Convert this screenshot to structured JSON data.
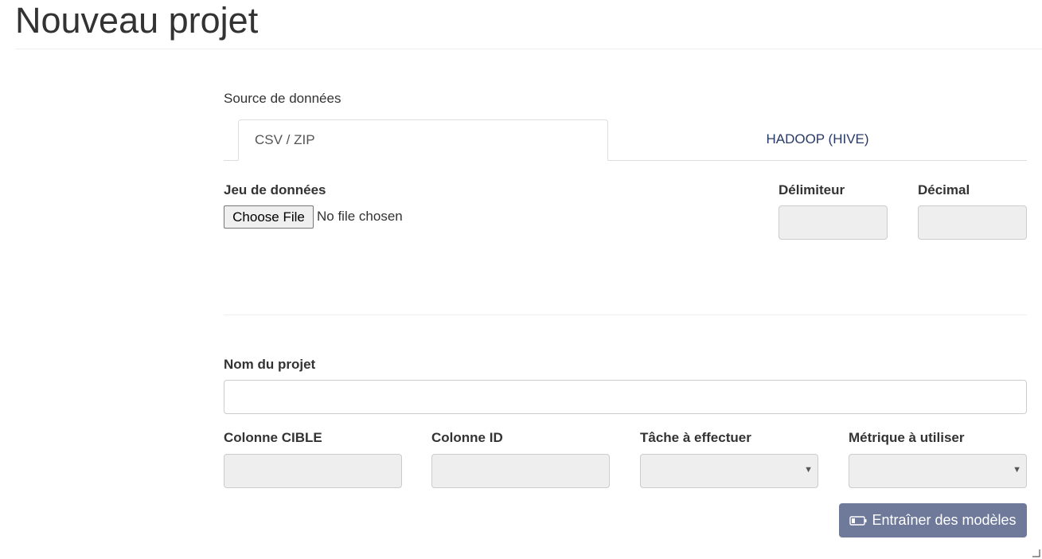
{
  "page": {
    "title": "Nouveau projet"
  },
  "source": {
    "label": "Source de données",
    "tabs": [
      {
        "label": "CSV / ZIP",
        "active": true
      },
      {
        "label": "HADOOP (HIVE)",
        "active": false
      }
    ]
  },
  "dataset": {
    "label": "Jeu de données",
    "file_button": "Choose File",
    "file_status": "No file chosen"
  },
  "delimiter": {
    "label": "Délimiteur",
    "value": ""
  },
  "decimal": {
    "label": "Décimal",
    "value": ""
  },
  "project_name": {
    "label": "Nom du projet",
    "value": ""
  },
  "target_column": {
    "label": "Colonne CIBLE",
    "value": ""
  },
  "id_column": {
    "label": "Colonne ID",
    "value": ""
  },
  "task": {
    "label": "Tâche à effectuer",
    "value": ""
  },
  "metric": {
    "label": "Métrique à utiliser",
    "value": ""
  },
  "actions": {
    "train_label": "Entraîner des modèles",
    "train_icon": "battery-icon"
  },
  "colors": {
    "accent": "#6f7a9a",
    "tab_link": "#2a3a66",
    "disabled_field": "#eeeeee"
  }
}
